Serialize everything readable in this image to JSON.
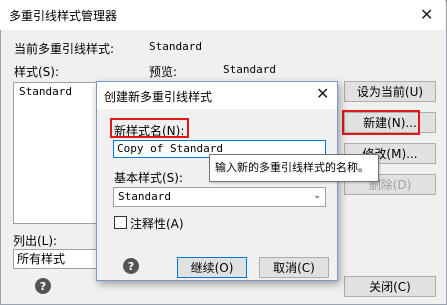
{
  "main": {
    "title": "多重引线样式管理器",
    "current_style_label": "当前多重引线样式:",
    "current_style_value": "Standard",
    "styles_label": "样式(S):",
    "preview_label": "预览:",
    "preview_value": "Standard",
    "styles": [
      "Standard"
    ],
    "buttons": {
      "set_current": "设为当前(U)",
      "new": "新建(N)...",
      "modify": "修改(M)...",
      "delete": "删除(D)",
      "close": "关闭(C)"
    },
    "list_label": "列出(L):",
    "list_value": "所有样式",
    "help_icon": "?"
  },
  "dialog": {
    "title": "创建新多重引线样式",
    "name_label": "新样式名(N):",
    "name_value": "Copy of Standard",
    "tooltip": "输入新的多重引线样式的名称。",
    "base_label": "基本样式(S):",
    "base_value": "Standard",
    "annotative_label": "注释性(A)",
    "continue_button": "继续(O)",
    "cancel_button": "取消(C)",
    "help_icon": "?"
  },
  "icons": {
    "close": "✕",
    "chevron": "⌄"
  },
  "colors": {
    "highlight_box": "#e01818",
    "focus_border": "#0078d7"
  }
}
